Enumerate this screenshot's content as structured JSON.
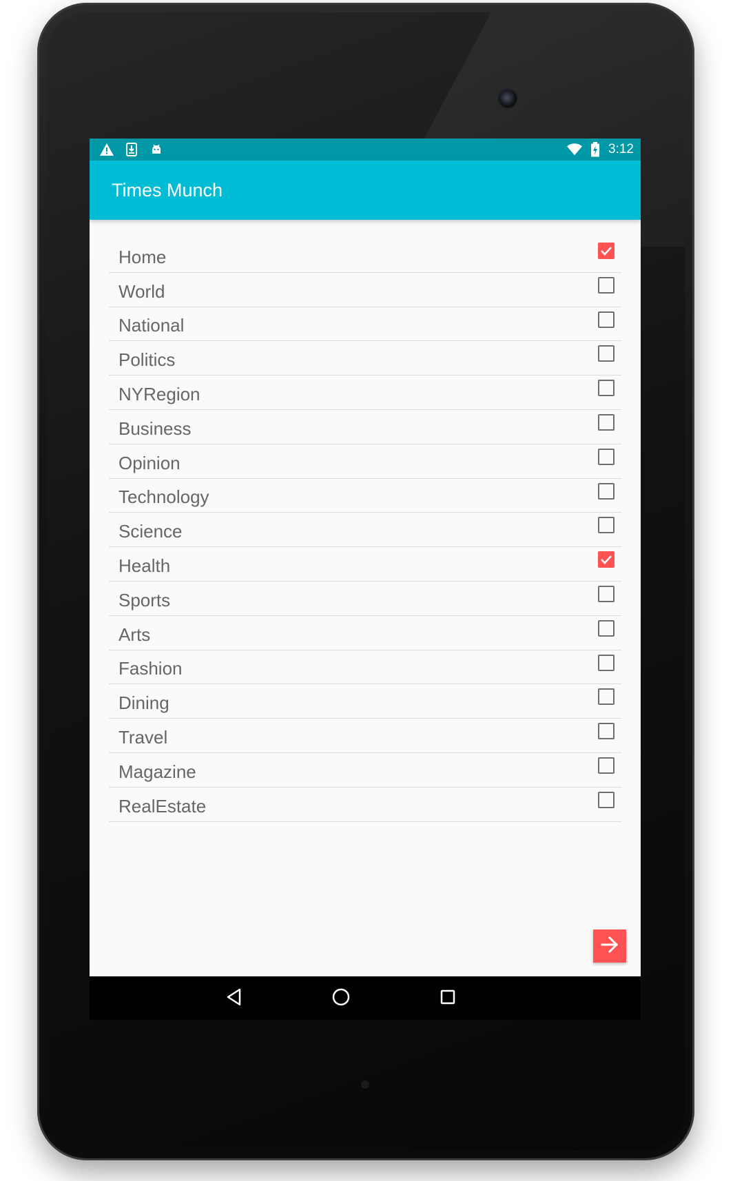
{
  "app": {
    "title": "Times Munch"
  },
  "status_bar": {
    "time": "3:12",
    "left_icons": [
      "warning-icon",
      "download-icon",
      "android-debug-icon"
    ],
    "right_icons": [
      "wifi-icon",
      "battery-charging-icon"
    ]
  },
  "sections": [
    {
      "label": "Home",
      "checked": true
    },
    {
      "label": "World",
      "checked": false
    },
    {
      "label": "National",
      "checked": false
    },
    {
      "label": "Politics",
      "checked": false
    },
    {
      "label": "NYRegion",
      "checked": false
    },
    {
      "label": "Business",
      "checked": false
    },
    {
      "label": "Opinion",
      "checked": false
    },
    {
      "label": "Technology",
      "checked": false
    },
    {
      "label": "Science",
      "checked": false
    },
    {
      "label": "Health",
      "checked": true
    },
    {
      "label": "Sports",
      "checked": false
    },
    {
      "label": "Arts",
      "checked": false
    },
    {
      "label": "Fashion",
      "checked": false
    },
    {
      "label": "Dining",
      "checked": false
    },
    {
      "label": "Travel",
      "checked": false
    },
    {
      "label": "Magazine",
      "checked": false
    },
    {
      "label": "RealEstate",
      "checked": false
    }
  ],
  "fab": {
    "icon": "arrow-right-icon"
  },
  "nav_bar": {
    "buttons": [
      "back-icon",
      "home-icon",
      "recents-icon"
    ]
  },
  "colors": {
    "status_bar": "#0097a7",
    "app_bar": "#00bcd4",
    "accent": "#ff5252",
    "background": "#fafafa"
  }
}
